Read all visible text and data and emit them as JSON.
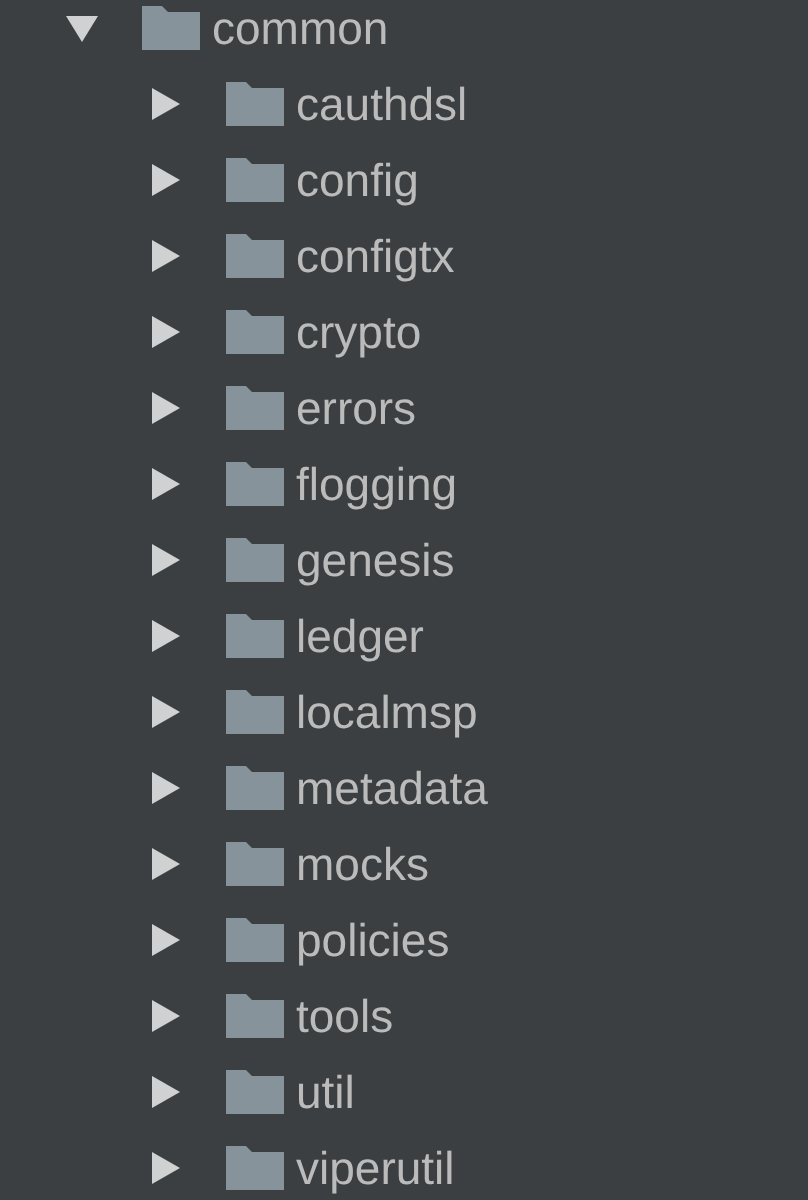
{
  "tree": [
    {
      "name": "common",
      "expanded": true,
      "children": [
        {
          "name": "cauthdsl",
          "expanded": false
        },
        {
          "name": "config",
          "expanded": false
        },
        {
          "name": "configtx",
          "expanded": false
        },
        {
          "name": "crypto",
          "expanded": false
        },
        {
          "name": "errors",
          "expanded": false
        },
        {
          "name": "flogging",
          "expanded": false
        },
        {
          "name": "genesis",
          "expanded": false
        },
        {
          "name": "ledger",
          "expanded": false
        },
        {
          "name": "localmsp",
          "expanded": false
        },
        {
          "name": "metadata",
          "expanded": false
        },
        {
          "name": "mocks",
          "expanded": false
        },
        {
          "name": "policies",
          "expanded": false
        },
        {
          "name": "tools",
          "expanded": false
        },
        {
          "name": "util",
          "expanded": false
        },
        {
          "name": "viperutil",
          "expanded": false
        }
      ]
    }
  ]
}
